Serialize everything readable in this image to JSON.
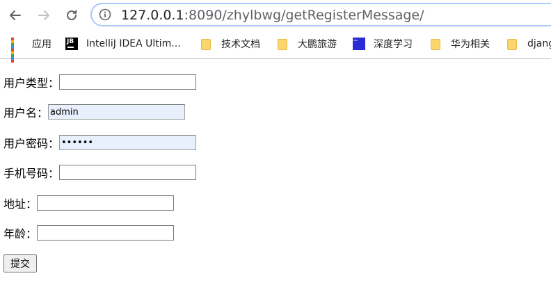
{
  "browser": {
    "url_host": "127.0.0.1",
    "url_rest": ":8090/zhylbwg/getRegisterMessage/"
  },
  "bookmarks": [
    {
      "label": "应用",
      "icon": "apps-grid-icon"
    },
    {
      "label": "IntelliJ IDEA Ultim...",
      "icon": "jetbrains-icon"
    },
    {
      "label": "技术文档",
      "icon": "folder-icon"
    },
    {
      "label": "大鹏旅游",
      "icon": "folder-icon"
    },
    {
      "label": "深度学习",
      "icon": "deep-learning-site-icon"
    },
    {
      "label": "华为相关",
      "icon": "folder-icon"
    },
    {
      "label": "djang",
      "icon": "folder-icon"
    }
  ],
  "form": {
    "user_type_label": "用户类型：",
    "user_type_value": "",
    "username_label": "用户名：",
    "username_value": "admin",
    "password_label": "用户密码：",
    "password_value": "••••••",
    "phone_label": "手机号码：",
    "phone_value": "",
    "address_label": "地址：",
    "address_value": "",
    "age_label": "年龄：",
    "age_value": "",
    "submit_label": "提交"
  },
  "colors": {
    "autofill_bg": "#e8f0fe",
    "omnibox_border": "#a8c7fa",
    "folder": "#fbd66d"
  }
}
